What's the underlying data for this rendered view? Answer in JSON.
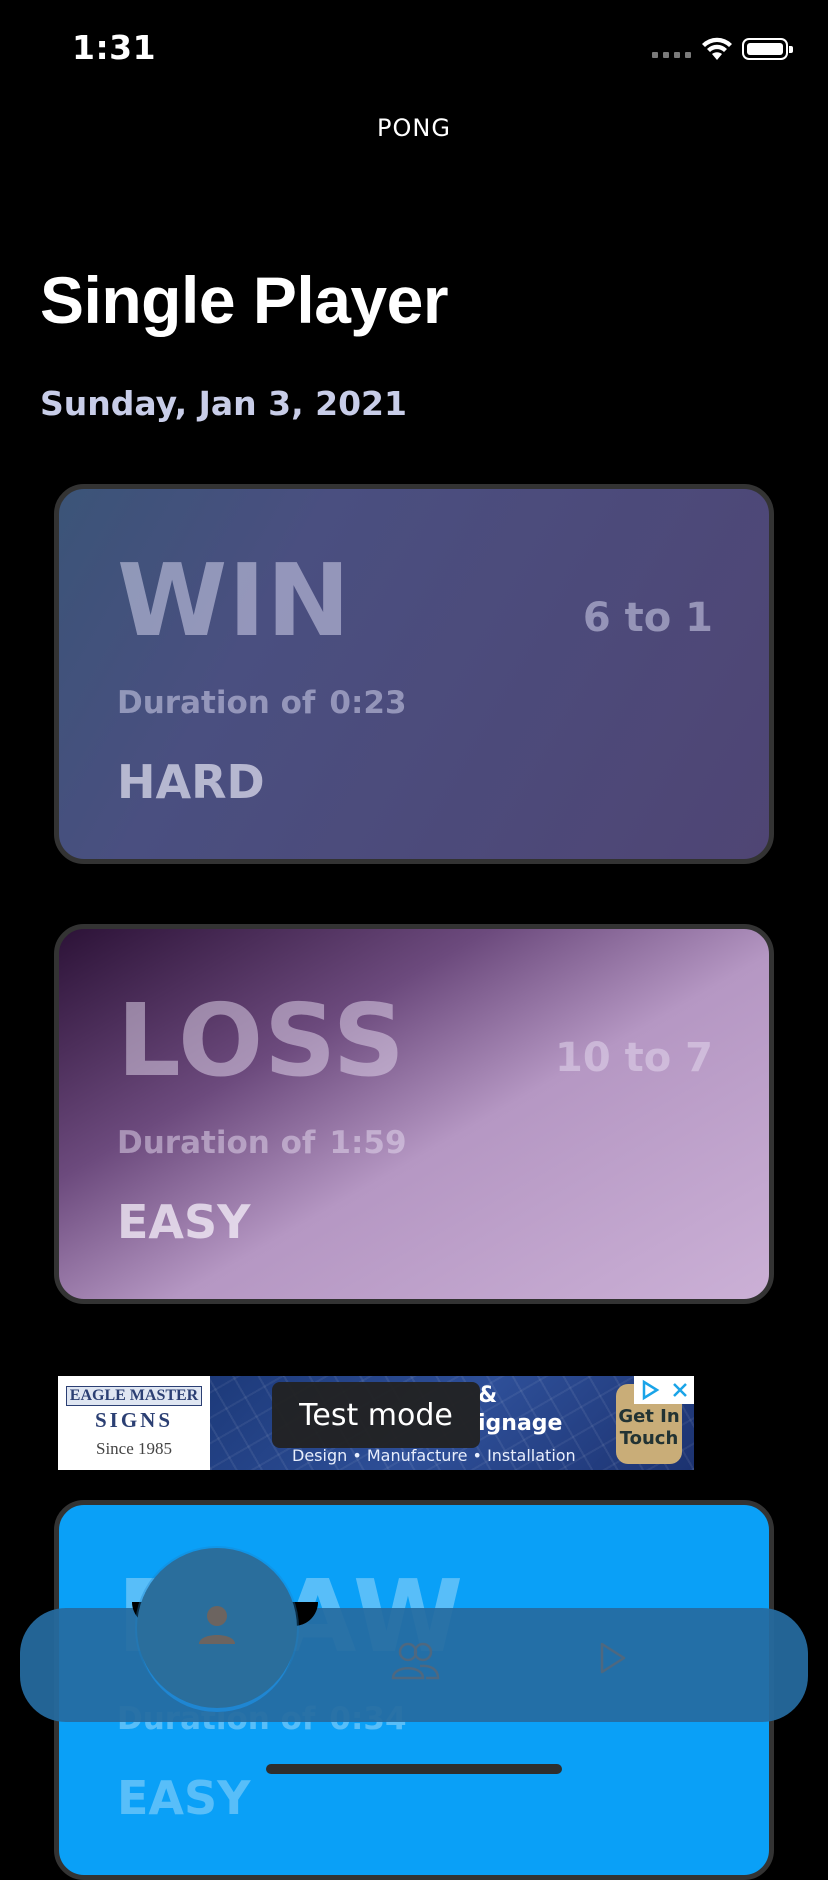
{
  "status_bar": {
    "time": "1:31"
  },
  "app": {
    "title": "PONG"
  },
  "page": {
    "title": "Single Player",
    "date": "Sunday, Jan 3, 2021"
  },
  "games": [
    {
      "result": "WIN",
      "score": "6 to 1",
      "duration_label": "Duration of",
      "duration": "0:23",
      "difficulty": "HARD"
    },
    {
      "result": "LOSS",
      "score": "10 to 7",
      "duration_label": "Duration of",
      "duration": "1:59",
      "difficulty": "EASY"
    },
    {
      "result": "DRAW",
      "duration_label": "Duration of",
      "duration": "0:34",
      "difficulty": "EASY"
    }
  ],
  "ad": {
    "brand_line1": "EAGLE MASTER",
    "brand_line2": "SIGNS",
    "brand_since": "Since 1985",
    "headline_line1": "&",
    "headline_line2": "ignage",
    "tagline": "Design • Manufacture • Installation",
    "cta": "Get In Touch",
    "test_mode": "Test mode"
  },
  "tabs": [
    {
      "name": "single-player",
      "icon": "person-icon",
      "active": true
    },
    {
      "name": "multiplayer",
      "icon": "people-icon",
      "active": false
    },
    {
      "name": "play",
      "icon": "play-icon",
      "active": false
    }
  ],
  "colors": {
    "background": "#000000",
    "win_card": "#4a4f80",
    "loss_card": "#b597c3",
    "draw_card": "#0aa0f7",
    "tab_bar": "#266ca0",
    "date_text": "#c8cde8"
  }
}
